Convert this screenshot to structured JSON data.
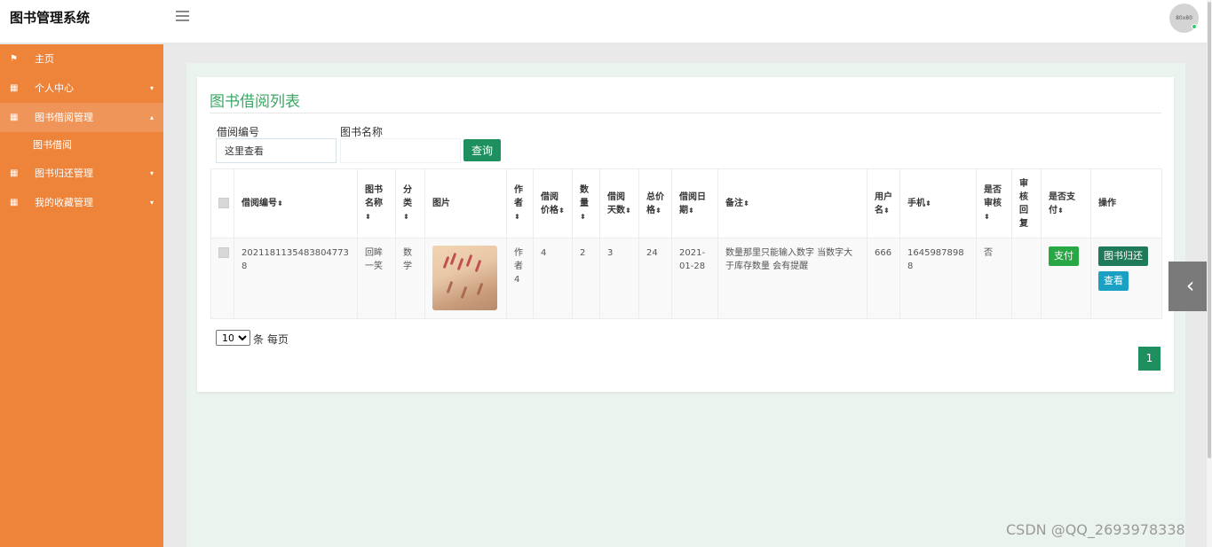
{
  "app": {
    "title": "图书管理系统",
    "avatar_text": "80x80"
  },
  "sidebar": {
    "items": [
      {
        "label": "主页"
      },
      {
        "label": "个人中心"
      },
      {
        "label": "图书借阅管理"
      },
      {
        "label": "图书借阅"
      },
      {
        "label": "图书归还管理"
      },
      {
        "label": "我的收藏管理"
      }
    ]
  },
  "page": {
    "title": "图书借阅列表"
  },
  "search": {
    "borrow_no_label": "借阅编号",
    "borrow_no_value": "这里查看",
    "book_name_label": "图书名称",
    "book_name_value": "",
    "query_button": "查询"
  },
  "table": {
    "headers": [
      "借阅编号",
      "图书名称",
      "分类",
      "图片",
      "作者",
      "借阅价格",
      "数量",
      "借阅天数",
      "总价格",
      "借阅日期",
      "备注",
      "用户名",
      "手机",
      "是否审核",
      "审核回复",
      "是否支付",
      "操作"
    ],
    "rows": [
      {
        "borrow_no": "20211811354838047738",
        "book_name": "回眸一笑",
        "category": "数学",
        "author": "作者4",
        "price": "4",
        "quantity": "2",
        "days": "3",
        "total": "24",
        "date": "2021-01-28",
        "remark": "数量那里只能输入数字 当数字大于库存数量 会有提醒",
        "username": "666",
        "phone": "16459878988",
        "audited": "否",
        "audit_reply": "",
        "actions": {
          "pay": "支付",
          "return": "图书归还",
          "view": "查看"
        }
      }
    ]
  },
  "pagination": {
    "page_size": "10",
    "page_size_label": "条 每页",
    "current_page": "1"
  },
  "watermark": "CSDN @QQ_2693978338",
  "colors": {
    "sidebar": "#ee833a",
    "accent": "#1e8f5e",
    "title": "#3aa865"
  }
}
